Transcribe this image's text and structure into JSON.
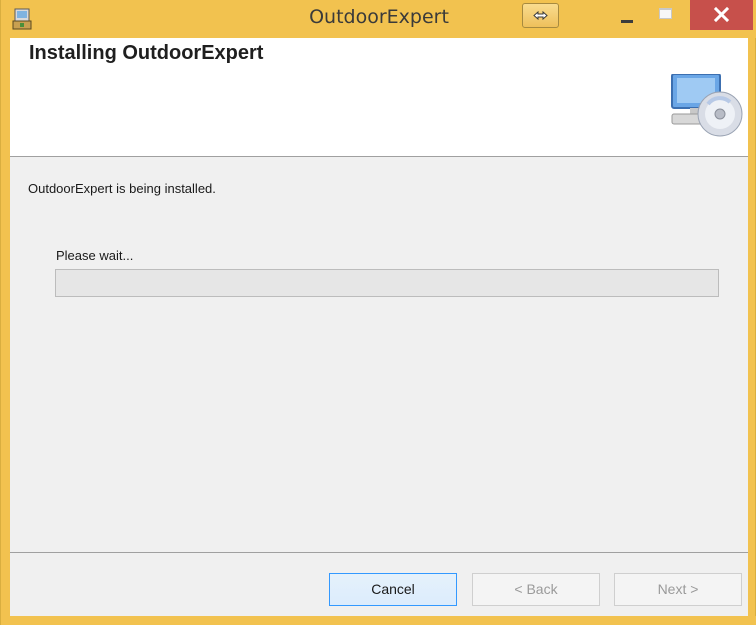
{
  "window": {
    "title": "OutdoorExpert",
    "accent_color": "#f2c24f",
    "close_color": "#c7504b"
  },
  "icons": {
    "app": "installer-icon",
    "resize": "resize-arrows-icon",
    "minimize": "minimize-icon",
    "maximize": "maximize-icon",
    "close": "close-icon",
    "header": "computer-disc-icon"
  },
  "header": {
    "title": "Installing OutdoorExpert"
  },
  "body": {
    "status_text": "OutdoorExpert is being installed.",
    "wait_label": "Please wait...",
    "progress_percent": 0
  },
  "footer": {
    "cancel_label": "Cancel",
    "back_label": "< Back",
    "next_label": "Next >"
  }
}
